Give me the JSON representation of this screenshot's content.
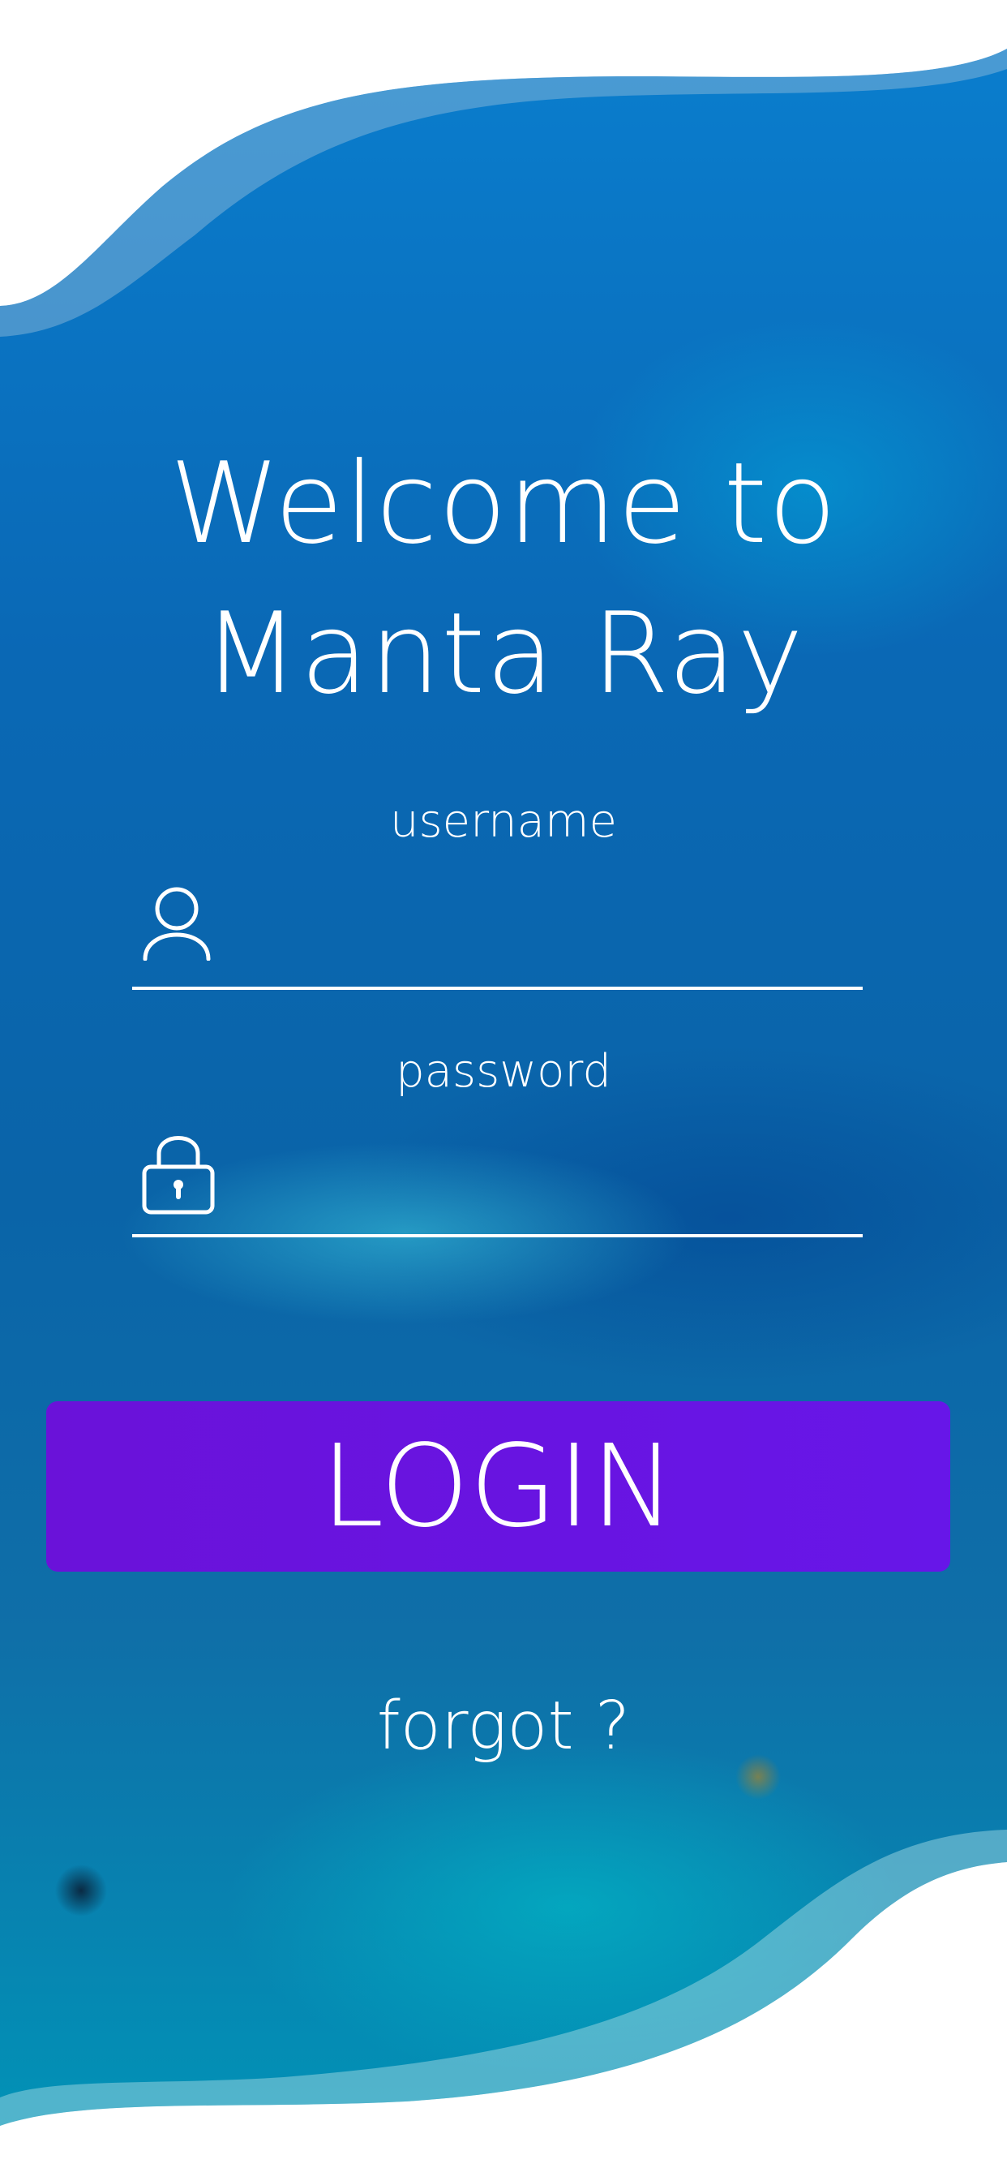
{
  "header": {
    "title_line1": "Welcome to",
    "title_line2": "Manta Ray"
  },
  "form": {
    "username_label": "username",
    "username_value": "",
    "username_icon": "user-icon",
    "password_label": "password",
    "password_value": "",
    "password_icon": "lock-icon"
  },
  "login_label": "LOGIN",
  "forgot_label": "forgot ?",
  "colors": {
    "button": "#6714e2",
    "wave": "#ffffff"
  }
}
